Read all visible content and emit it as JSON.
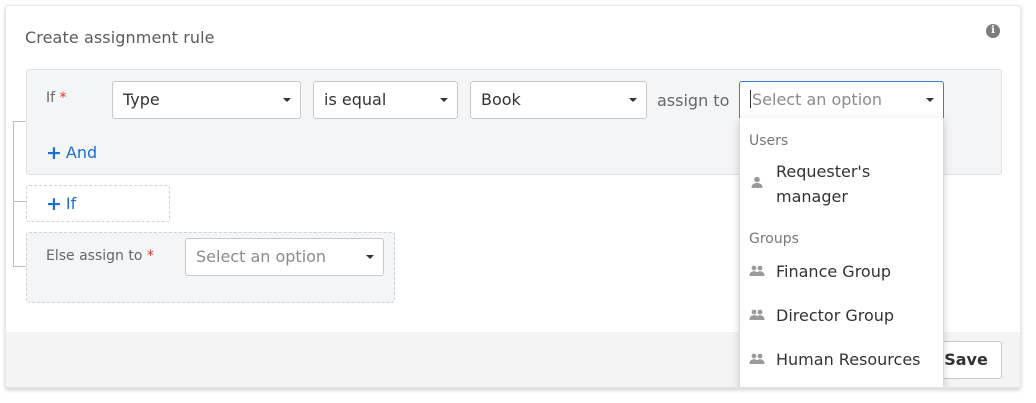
{
  "panel": {
    "title": "Create assignment rule",
    "info_icon": "i"
  },
  "rule": {
    "if_label": "If",
    "required_mark": "*",
    "field_select": {
      "value": "Type"
    },
    "operator_select": {
      "value": "is equal"
    },
    "value_select": {
      "value": "Book"
    },
    "assign_to_label": "assign to",
    "assignee_select": {
      "placeholder": "Select an option"
    },
    "add_and_label": "And"
  },
  "add_if_label": "If",
  "else": {
    "label": "Else assign to",
    "required_mark": "*",
    "select": {
      "placeholder": "Select an option"
    }
  },
  "dropdown": {
    "groups": [
      {
        "header": "Users",
        "options": [
          {
            "label": "Requester's manager",
            "icon": "user-icon"
          }
        ]
      },
      {
        "header": "Groups",
        "options": [
          {
            "label": "Finance Group",
            "icon": "group-icon"
          },
          {
            "label": "Director Group",
            "icon": "group-icon"
          },
          {
            "label": "Human Resources",
            "icon": "group-icon"
          }
        ]
      }
    ]
  },
  "footer": {
    "save_label": "Save"
  },
  "colors": {
    "accent": "#1a6fd1",
    "required": "#d9342b",
    "focus_border": "#3a7fd6"
  }
}
